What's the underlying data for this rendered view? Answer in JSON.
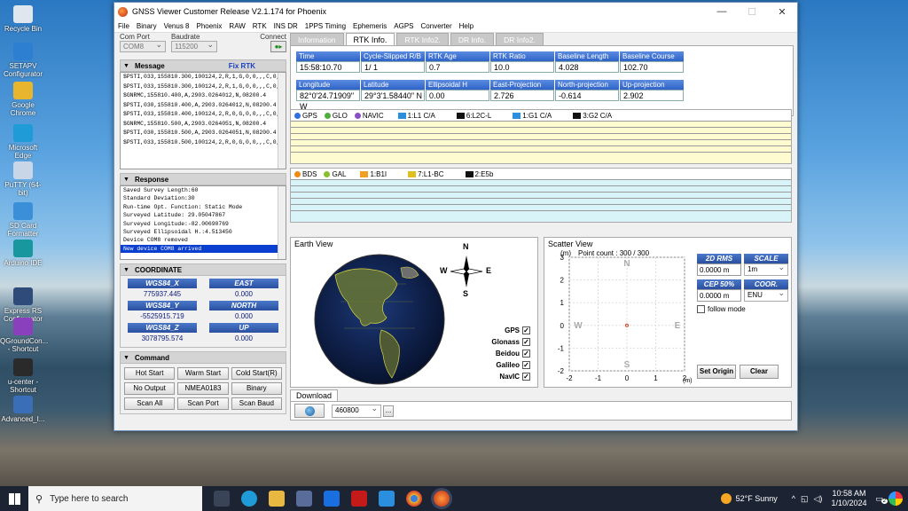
{
  "desktop": {
    "icons": [
      {
        "label": "Recycle Bin",
        "color": "#dfe6ee"
      },
      {
        "label": "SETAPV Configurator",
        "color": "#2d7fd2"
      },
      {
        "label": "Google Chrome",
        "color": "#e8b52e"
      },
      {
        "label": "Microsoft Edge",
        "color": "#1f9bd7"
      },
      {
        "label": "PuTTY (64-bit)",
        "color": "#c9d6e8"
      },
      {
        "label": "SD Card Formatter",
        "color": "#3a8fd8"
      },
      {
        "label": "Arduino IDE",
        "color": "#18979e"
      },
      {
        "label": "Express RS Configurator",
        "color": "#2f4b7a"
      },
      {
        "label": "QGroundCon... - Shortcut",
        "color": "#8a3fbc"
      },
      {
        "label": "u-center - Shortcut",
        "color": "#2a2a2a"
      },
      {
        "label": "Advanced_I...",
        "color": "#3a6fb8"
      }
    ]
  },
  "window": {
    "title": "GNSS Viewer Customer Release V2.1.174 for Phoenix"
  },
  "menu": [
    "File",
    "Binary",
    "Venus 8",
    "Phoenix",
    "RAW",
    "RTK",
    "INS DR",
    "1PPS Timing",
    "Ephemeris",
    "AGPS",
    "Converter",
    "Help"
  ],
  "connection": {
    "com_port_label": "Com Port",
    "com_port_value": "COM8",
    "baudrate_label": "Baudrate",
    "baudrate_value": "115200",
    "connect_label": "Connect"
  },
  "message": {
    "title": "Message",
    "fix": "Fix RTK",
    "lines": [
      "$PSTI,033,155810.300,100124,2,R,1,G,0,0,,,C,0,0,,,",
      "$PSTI,033,155810.300,100124,2,R,1,G,0,0,,,C,0,0,,,",
      "$GNRMC,155810.400,A,2903.0264012,N,08200.4",
      "$PSTI,030,155810.400,A,2903.0264012,N,08200.4",
      "$PSTI,033,155810.400,100124,2,R,0,G,0,0,,,C,0,0,",
      "$GNRMC,155810.500,A,2903.0264051,N,08200.4",
      "$PSTI,030,155810.500,A,2903.0264051,N,08200.4",
      "$PSTI,033,155810.500,100124,2,R,0,G,0,0,,,C,0,0,"
    ]
  },
  "response": {
    "title": "Response",
    "lines": [
      "Saved Survey Length:60",
      "Standard Deviation:30",
      "Run-time Opt. Function: Static Mode",
      "Surveyed Latitude: 29.05047867",
      "Surveyed Longitude:-82.00690769",
      "Surveyed Ellipsoidal H.:4.513450",
      "Device COM8 removed",
      "New device COM8 arrived"
    ]
  },
  "coordinate": {
    "title": "COORDINATE",
    "rows": [
      {
        "l1": "WGS84_X",
        "v1": "775937.445",
        "l2": "EAST",
        "v2": "0.000"
      },
      {
        "l1": "WGS84_Y",
        "v1": "-5525915.719",
        "l2": "NORTH",
        "v2": "0.000"
      },
      {
        "l1": "WGS84_Z",
        "v1": "3078795.574",
        "l2": "UP",
        "v2": "0.000"
      }
    ]
  },
  "command": {
    "title": "Command",
    "buttons": [
      "Hot Start",
      "Warm Start",
      "Cold Start(R)",
      "No Output",
      "NMEA0183",
      "Binary",
      "Scan All",
      "Scan Port",
      "Scan Baud"
    ]
  },
  "tabs": [
    "Information",
    "RTK Info.",
    "RTK Info2.",
    "DR Info.",
    "DR Info2."
  ],
  "rtk": [
    {
      "label": "Time",
      "value": "15:58:10.70"
    },
    {
      "label": "Cycle-Slipped R/B",
      "value": "1/   1"
    },
    {
      "label": "RTK  Age",
      "value": "0.7"
    },
    {
      "label": "RTK  Ratio",
      "value": "10.0"
    },
    {
      "label": "Baseline  Length",
      "value": "4.028"
    },
    {
      "label": "Baseline  Course",
      "value": "102.70"
    },
    {
      "label": "Longitude",
      "value": "82°0'24.71909\" W"
    },
    {
      "label": "Latitude",
      "value": "29°3'1.58440\" N"
    },
    {
      "label": "Ellipsoidal H",
      "value": "0.00"
    },
    {
      "label": "East-Projection",
      "value": "2.726"
    },
    {
      "label": "North-projection",
      "value": "-0.614"
    },
    {
      "label": "Up-projection",
      "value": "2.902"
    }
  ],
  "sat1": {
    "constellations": [
      {
        "name": "GPS",
        "color": "#2f6fe0"
      },
      {
        "name": "GLO",
        "color": "#4caf3a"
      },
      {
        "name": "NAVIC",
        "color": "#8a4fc8"
      }
    ],
    "bands": [
      {
        "name": "1:L1 C/A",
        "color": "#2b8fe0"
      },
      {
        "name": "6:L2C-L",
        "color": "#111"
      },
      {
        "name": "1:G1 C/A",
        "color": "#2b8fe0"
      },
      {
        "name": "3:G2 C/A",
        "color": "#111"
      }
    ]
  },
  "sat2": {
    "constellations": [
      {
        "name": "BDS",
        "color": "#f08a10"
      },
      {
        "name": "GAL",
        "color": "#8ac030"
      }
    ],
    "bands": [
      {
        "name": "1:B1I",
        "color": "#f0a020"
      },
      {
        "name": "7:L1-BC",
        "color": "#e0c020"
      },
      {
        "name": "2:E5b",
        "color": "#111"
      }
    ]
  },
  "earth": {
    "title": "Earth View",
    "compass": [
      "N",
      "E",
      "S",
      "W"
    ],
    "checks": [
      {
        "name": "GPS",
        "checked": "✓"
      },
      {
        "name": "Glonass",
        "checked": "✓"
      },
      {
        "name": "Beidou",
        "checked": "✓"
      },
      {
        "name": "Galileo",
        "checked": "✓"
      },
      {
        "name": "NavIC",
        "checked": "✓"
      }
    ]
  },
  "scatter": {
    "title": "Scatter View",
    "unit": "(m)",
    "point_count": "Point count : 300 / 300",
    "y_ticks": [
      "3",
      "2",
      "1",
      "0",
      "-1",
      "-2"
    ],
    "x_ticks": [
      "-2",
      "-1",
      "0",
      "1",
      "2"
    ],
    "dirs": [
      "N",
      "E",
      "S",
      "W"
    ],
    "rms_label": "2D RMS",
    "rms_value": "0.0000 m",
    "scale_label": "SCALE",
    "scale_value": "1m",
    "cep_label": "CEP 50%",
    "cep_value": "0.0000 m",
    "coor_label": "COOR.",
    "coor_value": "ENU",
    "follow": "follow mode",
    "set_origin": "Set Origin",
    "clear": "Clear"
  },
  "download": {
    "tab": "Download",
    "baud": "460800",
    "more": "..."
  },
  "taskbar": {
    "search": "Type here to search",
    "weather": "52°F  Sunny",
    "time": "10:58 AM",
    "date": "1/10/2024",
    "notif": "2"
  }
}
